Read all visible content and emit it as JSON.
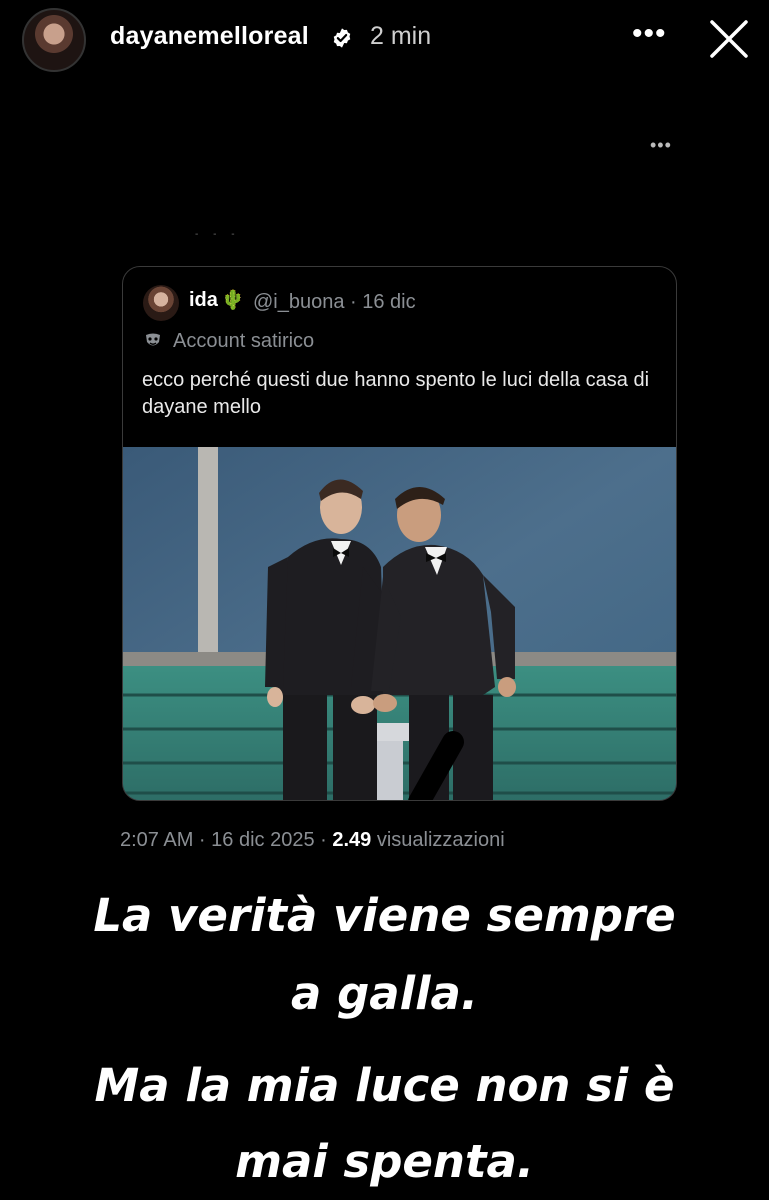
{
  "story_header": {
    "username": "dayanemelloreal",
    "time_ago": "2 min",
    "more_label": "•••",
    "close_label": "close"
  },
  "post_more_label": "•••",
  "tweet": {
    "author_name": "ida",
    "author_emoji": "🌵",
    "handle_date": "@i_buona · 16 dic",
    "account_tag": "Account satirico",
    "text": "ecco perché questi due hanno spento le luci della casa di dayane mello",
    "meta_time": "2:07 AM · 16 dic 2025 · ",
    "meta_views_count": "2.49",
    "meta_views_label": " visualizzazioni"
  },
  "captions": {
    "line1": "La verità viene sempre",
    "line2": "a galla.",
    "line3": "Ma la mia luce non si è",
    "line4": "mai spenta."
  },
  "colors": {
    "background": "#000000",
    "muted_text": "#8b8f94",
    "verified_badge": "#ffffff"
  }
}
